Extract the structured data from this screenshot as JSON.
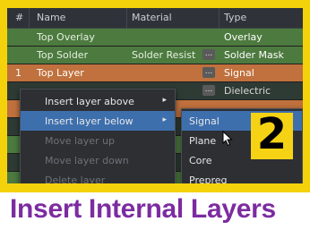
{
  "colors": {
    "frame": "#f4d20b",
    "caption": "#7c2ca0",
    "highlight": "#3d6fad",
    "badge": "#f6d215"
  },
  "header": {
    "num": "#",
    "name": "Name",
    "material": "Material",
    "type": "Type"
  },
  "rows": [
    {
      "num": "",
      "name": "Top Overlay",
      "material": "",
      "type": "Overlay"
    },
    {
      "num": "",
      "name": "Top Solder",
      "material": "Solder Resist",
      "dots": "...",
      "type": "Solder Mask"
    },
    {
      "num": "1",
      "name": "Top Layer",
      "material": "",
      "dots": "...",
      "type": "Signal"
    },
    {
      "num": "",
      "name": "",
      "material": "",
      "dots": "...",
      "type": "Dielectric"
    }
  ],
  "context_menu": {
    "items": [
      {
        "label": "Insert layer above",
        "arrow": "▸"
      },
      {
        "label": "Insert layer below",
        "arrow": "▸"
      },
      {
        "label": "Move layer up"
      },
      {
        "label": "Move layer down"
      },
      {
        "label": "Delete layer"
      }
    ]
  },
  "submenu": {
    "items": [
      {
        "label": "Signal"
      },
      {
        "label": "Plane"
      },
      {
        "label": "Core"
      },
      {
        "label": "Prepreg"
      }
    ]
  },
  "badge": {
    "number": "2"
  },
  "caption": {
    "text": "Insert Internal Layers"
  }
}
